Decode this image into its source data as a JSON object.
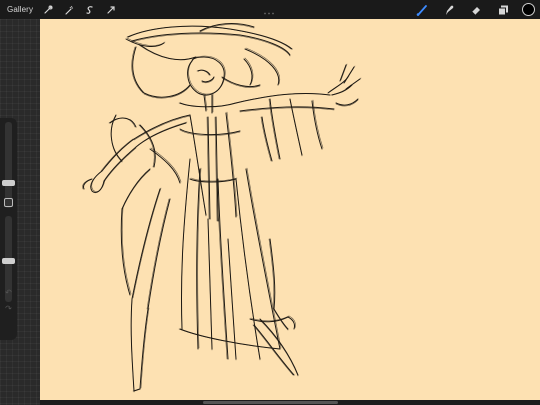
{
  "toolbar": {
    "gallery_label": "Gallery",
    "left_tools": [
      "wrench-icon",
      "magic-wand-icon",
      "selection-icon",
      "transform-icon"
    ],
    "right_tools": [
      "brush-icon",
      "smudge-icon",
      "eraser-icon",
      "layers-icon"
    ],
    "active_tool": "brush-icon",
    "active_color": "#3d8bff",
    "current_color": "#000000"
  },
  "sidebar": {
    "brush_size_level": 0.27,
    "opacity_level": 0.47
  },
  "canvas": {
    "background_color": "#fde1b2",
    "stroke_color": "#1e1a14"
  }
}
